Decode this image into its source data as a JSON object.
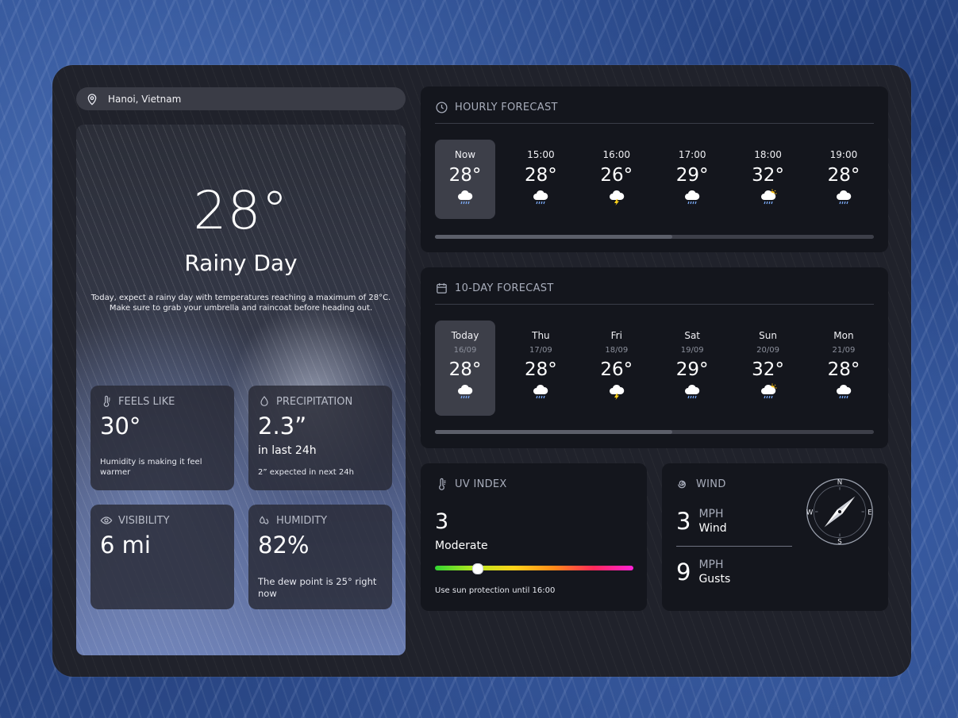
{
  "location": {
    "name": "Hanoi, Vietnam",
    "icon": "map-pin-icon"
  },
  "current": {
    "temperature": "28°",
    "condition": "Rainy Day",
    "description": "Today, expect a rainy day with temperatures reaching a maximum of 28°C. Make sure to grab your umbrella and raincoat before heading out."
  },
  "stats": {
    "feels_like": {
      "title": "FEELS LIKE",
      "value": "30°",
      "note": "Humidity is making it feel warmer",
      "icon": "thermometer-icon"
    },
    "precipitation": {
      "title": "PRECIPITATION",
      "value": "2.3”",
      "sub": "in last 24h",
      "note": "2” expected in next 24h",
      "icon": "droplet-icon"
    },
    "visibility": {
      "title": "VISIBILITY",
      "value": "6 mi",
      "icon": "eye-icon"
    },
    "humidity": {
      "title": "HUMIDITY",
      "value": "82%",
      "note": "The dew point is 25° right now",
      "icon": "droplets-icon"
    }
  },
  "hourly": {
    "title": "HOURLY FORECAST",
    "scroll_position": 0.54,
    "items": [
      {
        "label": "Now",
        "temp": "28°",
        "icon": "rain-cloud-icon",
        "active": true
      },
      {
        "label": "15:00",
        "temp": "28°",
        "icon": "rain-cloud-icon"
      },
      {
        "label": "16:00",
        "temp": "26°",
        "icon": "thunder-cloud-icon"
      },
      {
        "label": "17:00",
        "temp": "29°",
        "icon": "rain-cloud-icon"
      },
      {
        "label": "18:00",
        "temp": "32°",
        "icon": "sun-rain-cloud-icon"
      },
      {
        "label": "19:00",
        "temp": "28°",
        "icon": "rain-cloud-icon"
      }
    ]
  },
  "daily": {
    "title": "10-DAY FORECAST",
    "scroll_position": 0.54,
    "items": [
      {
        "day": "Today",
        "date": "16/09",
        "temp": "28°",
        "icon": "rain-cloud-icon",
        "active": true
      },
      {
        "day": "Thu",
        "date": "17/09",
        "temp": "28°",
        "icon": "rain-cloud-icon"
      },
      {
        "day": "Fri",
        "date": "18/09",
        "temp": "26°",
        "icon": "thunder-cloud-icon"
      },
      {
        "day": "Sat",
        "date": "19/09",
        "temp": "29°",
        "icon": "rain-cloud-icon"
      },
      {
        "day": "Sun",
        "date": "20/09",
        "temp": "32°",
        "icon": "sun-rain-cloud-icon"
      },
      {
        "day": "Mon",
        "date": "21/09",
        "temp": "28°",
        "icon": "rain-cloud-icon"
      }
    ]
  },
  "uv": {
    "title": "UV INDEX",
    "value": "3",
    "category": "Moderate",
    "level_fraction": 0.21,
    "note": "Use sun protection until 16:00",
    "icon": "thermometer-icon"
  },
  "wind": {
    "title": "WIND",
    "icon": "wind-spiral-icon",
    "speed": {
      "value": "3",
      "unit": "MPH",
      "kind": "Wind"
    },
    "gusts": {
      "value": "9",
      "unit": "MPH",
      "kind": "Gusts"
    },
    "compass": {
      "n": "N",
      "e": "E",
      "s": "S",
      "w": "W"
    },
    "direction_deg": 45
  },
  "colors": {
    "panel": "#20222b",
    "card": "#14161d",
    "active": "#3d3f49",
    "accent_text": "#a8adbb"
  }
}
